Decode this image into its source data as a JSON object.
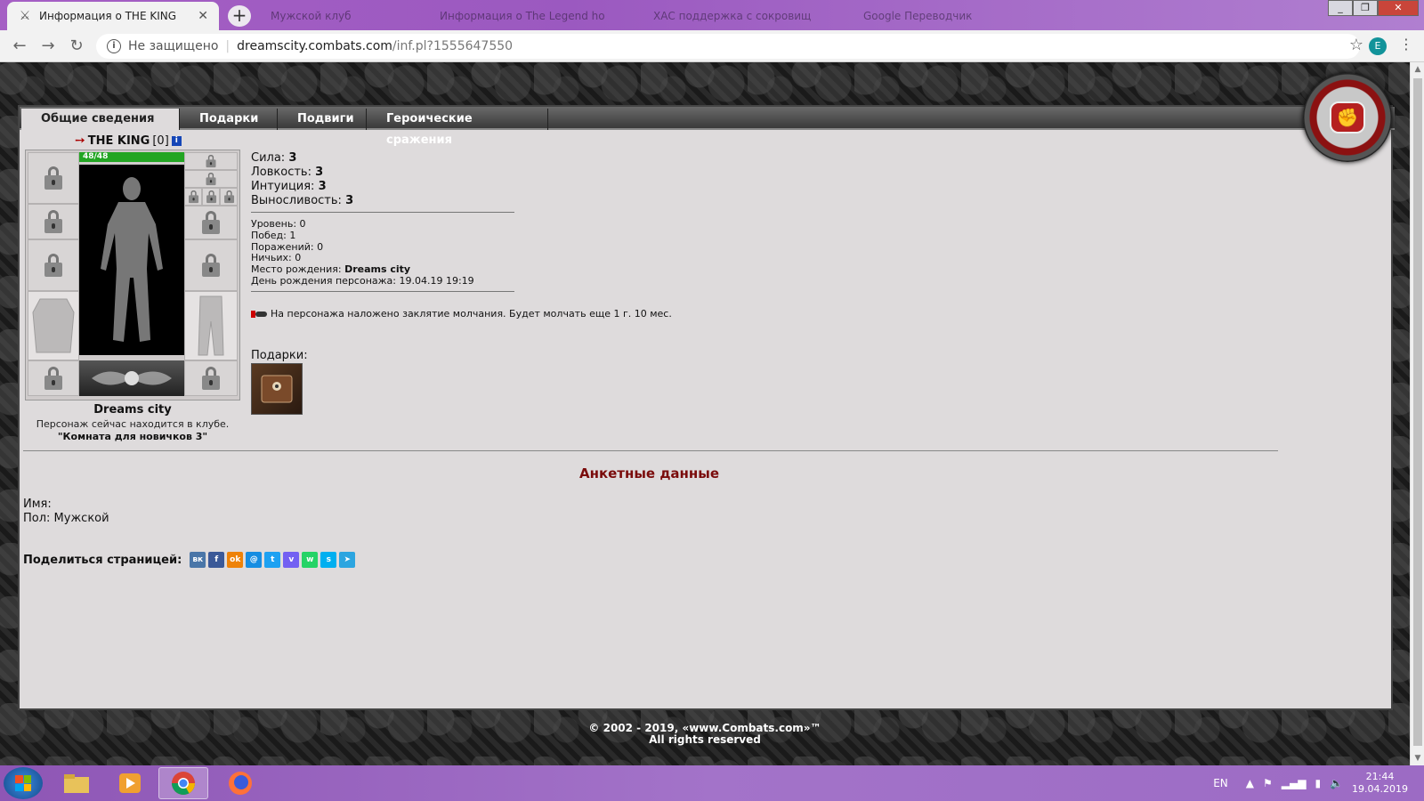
{
  "browser": {
    "active_tab": {
      "title": "Информация о THE KING",
      "icon": "crossed-swords-icon"
    },
    "inactive_tabs": [
      {
        "title": "Мужской клуб"
      },
      {
        "title": "Информация о The Legend ho"
      },
      {
        "title": "ХАС поддержка с сокровищ"
      },
      {
        "title": "Google Переводчик"
      }
    ],
    "address": {
      "security_label": "Не защищено",
      "host": "dreamscity.combats.com",
      "path": "/inf.pl?1555647550"
    },
    "profile_letter": "E",
    "profile_color": "#12939a"
  },
  "page": {
    "tabs": [
      {
        "label": "Общие сведения",
        "active": true
      },
      {
        "label": "Подарки",
        "active": false
      },
      {
        "label": "Подвиги",
        "active": false
      },
      {
        "label": "Героические сражения",
        "active": false
      }
    ],
    "character": {
      "name": "THE KING",
      "level_text": "[0]",
      "hp": "48/48",
      "city": "Dreams city",
      "location_text": "Персонаж сейчас находится в клубе.",
      "room": "\"Комната для новичков 3\""
    },
    "stats": [
      {
        "label": "Сила:",
        "value": "3"
      },
      {
        "label": "Ловкость:",
        "value": "3"
      },
      {
        "label": "Интуиция:",
        "value": "3"
      },
      {
        "label": "Выносливость:",
        "value": "3"
      }
    ],
    "info": {
      "level": "Уровень: 0",
      "wins": "Побед: 1",
      "losses": "Поражений: 0",
      "draws": "Ничьих: 0",
      "birthplace_label": "Место рождения:",
      "birthplace": "Dreams city",
      "birthday": "День рождения персонажа: 19.04.19 19:19"
    },
    "silence_text": "На персонажа наложено заклятие молчания. Будет молчать еще 1 г. 10 мес.",
    "gifts_label": "Подарки:",
    "anketa": {
      "title": "Анкетные данные",
      "name_label": "Имя:",
      "gender": "Пол: Мужской"
    },
    "share": {
      "label": "Поделиться страницей:",
      "networks": [
        {
          "name": "vk",
          "glyph": "вк",
          "color": "#4a76a8"
        },
        {
          "name": "facebook",
          "glyph": "f",
          "color": "#3b5998"
        },
        {
          "name": "odnoklassniki",
          "glyph": "ok",
          "color": "#ee8208"
        },
        {
          "name": "moimir",
          "glyph": "@",
          "color": "#168de2"
        },
        {
          "name": "twitter",
          "glyph": "t",
          "color": "#1da1f2"
        },
        {
          "name": "viber",
          "glyph": "v",
          "color": "#7360f2"
        },
        {
          "name": "whatsapp",
          "glyph": "w",
          "color": "#25d366"
        },
        {
          "name": "skype",
          "glyph": "s",
          "color": "#00aff0"
        },
        {
          "name": "telegram",
          "glyph": "➤",
          "color": "#2ca5e0"
        }
      ]
    },
    "footer": {
      "copyright": "© 2002 - 2019, «www.Combats.com»™",
      "rights": "All rights reserved"
    }
  },
  "taskbar": {
    "lang": "EN",
    "time": "21:44",
    "date": "19.04.2019"
  }
}
